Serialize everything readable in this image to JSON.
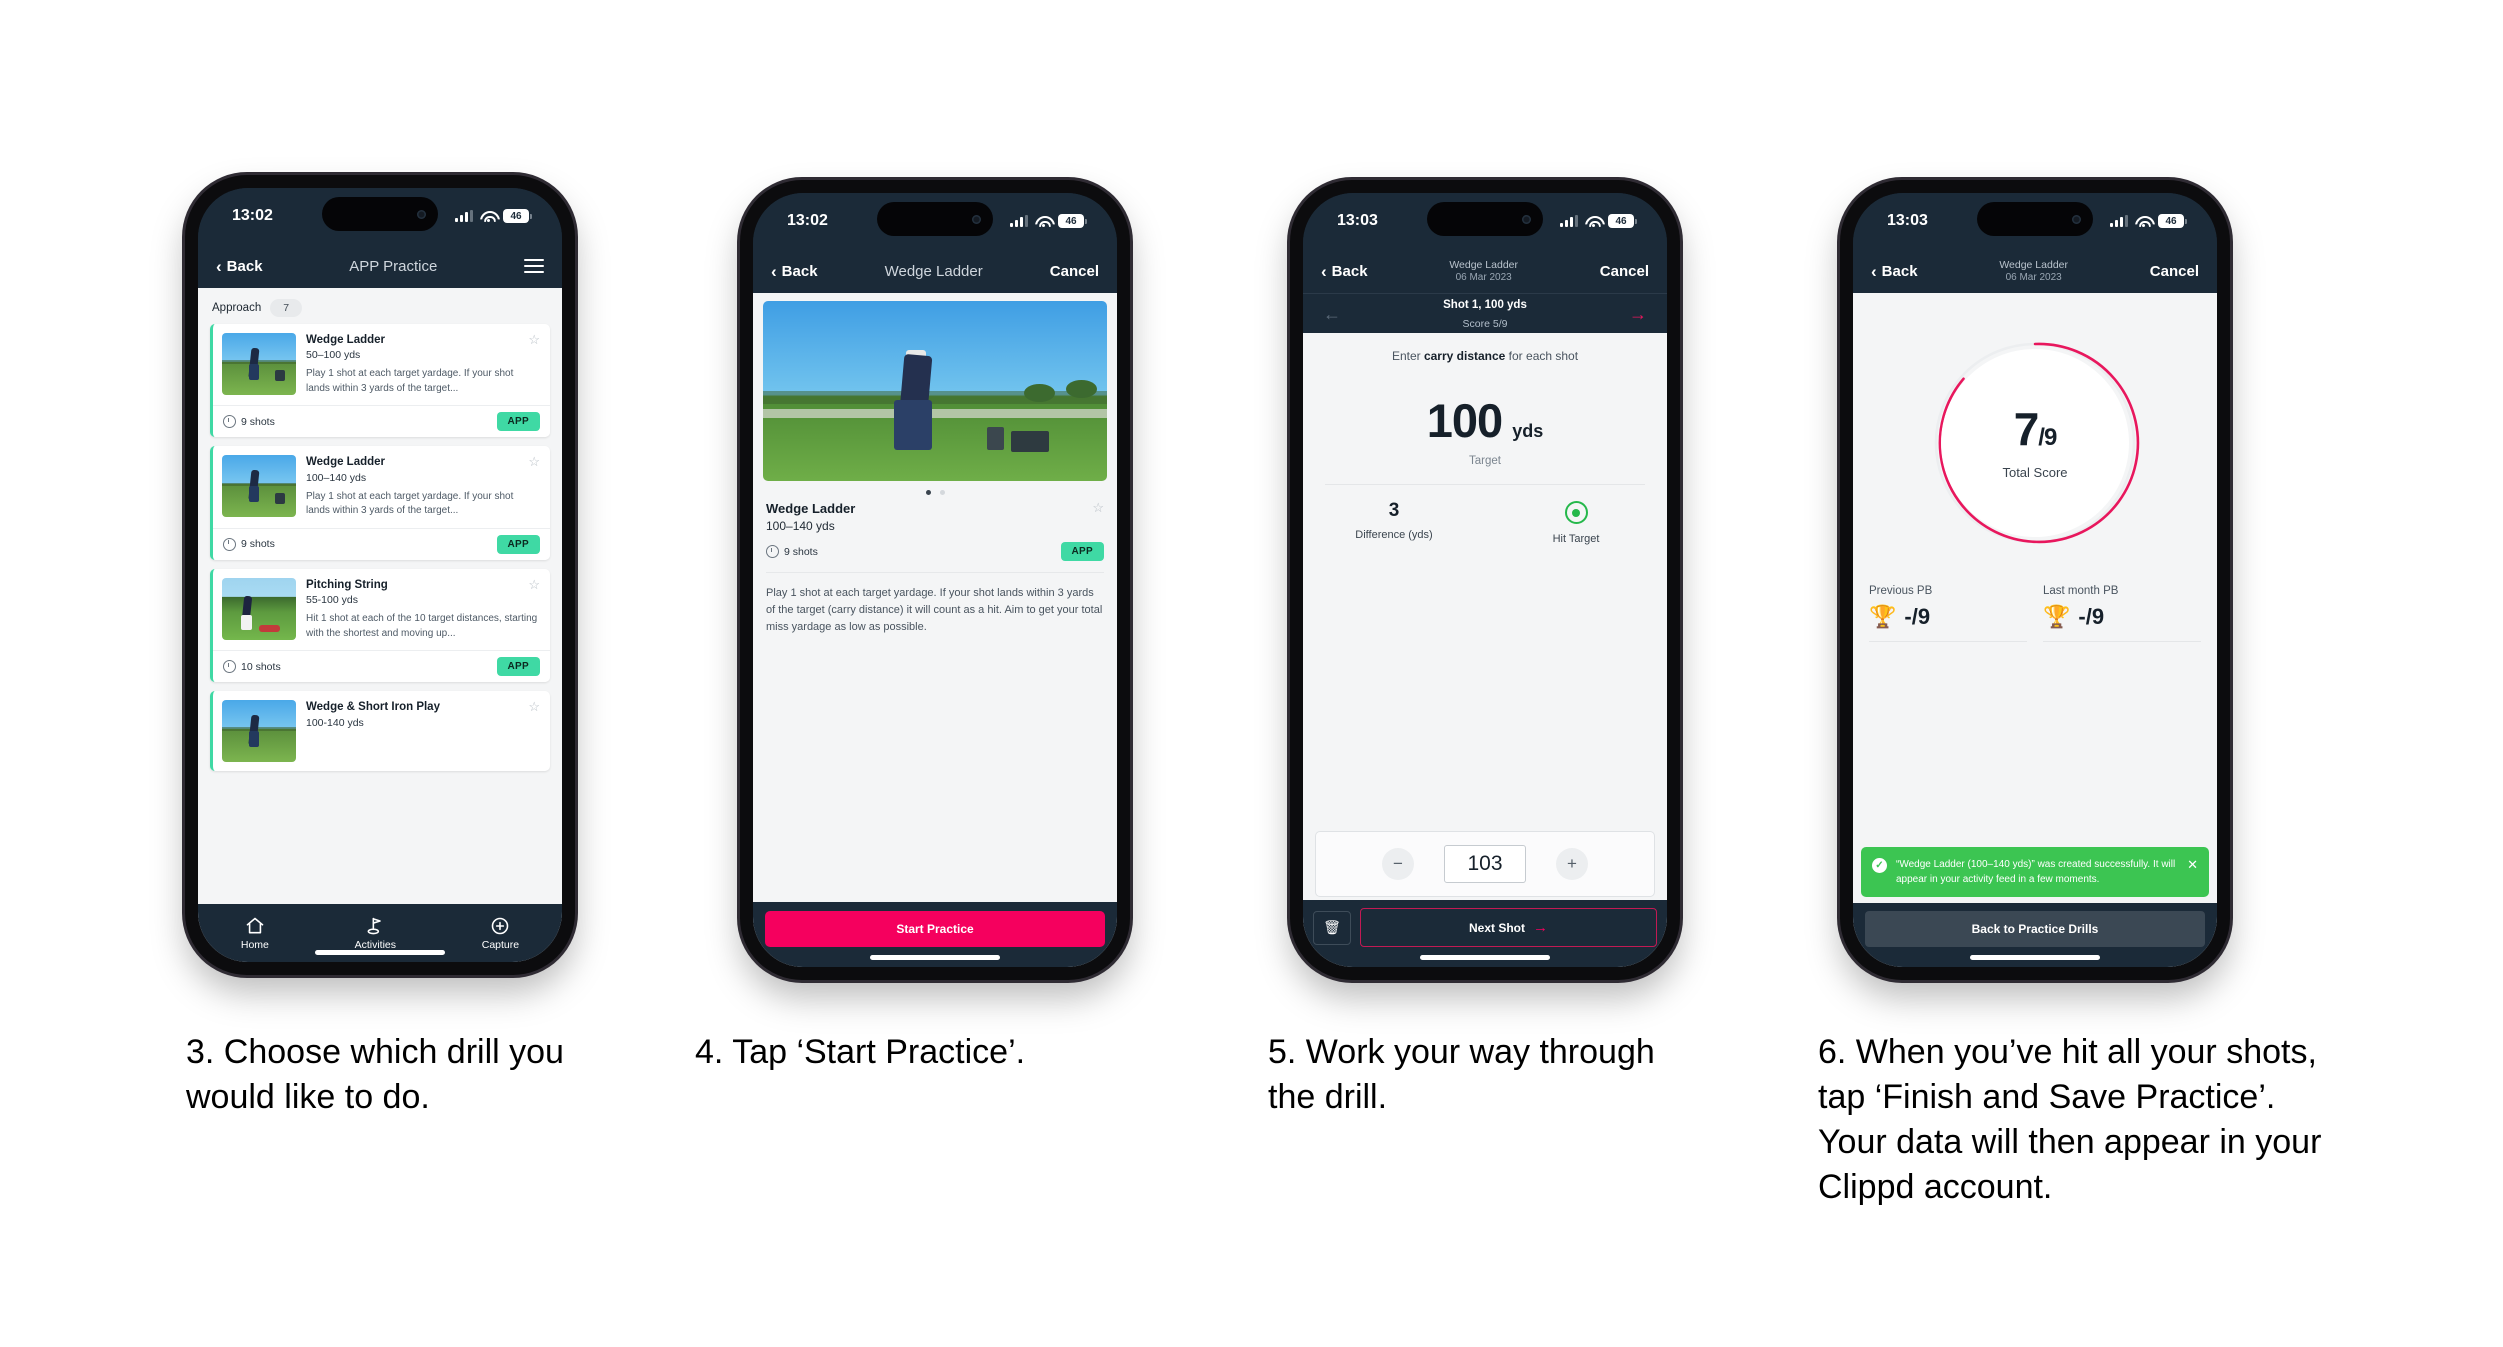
{
  "colors": {
    "dark_navy": "#1b2a38",
    "accent_pink": "#f5005e",
    "mint": "#3fd9a4",
    "toast_green": "#3cc552",
    "hit_green": "#25b84b",
    "page_bg": "#ffffff"
  },
  "phones": [
    {
      "status": {
        "time": "13:02",
        "battery": "46"
      },
      "nav": {
        "back": "Back",
        "title": "APP Practice",
        "menu_icon": "hamburger-icon"
      },
      "filter": {
        "label": "Approach",
        "count": "7"
      },
      "cards": [
        {
          "title": "Wedge Ladder",
          "yardage": "50–100 yds",
          "description": "Play 1 shot at each target yardage. If your shot lands within 3 yards of the target...",
          "shots": "9 shots",
          "badge": "APP"
        },
        {
          "title": "Wedge Ladder",
          "yardage": "100–140 yds",
          "description": "Play 1 shot at each target yardage. If your shot lands within 3 yards of the target...",
          "shots": "9 shots",
          "badge": "APP"
        },
        {
          "title": "Pitching String",
          "yardage": "55-100 yds",
          "description": "Hit 1 shot at each of the 10 target distances, starting with the shortest and moving up...",
          "shots": "10 shots",
          "badge": "APP"
        },
        {
          "title": "Wedge & Short Iron Play",
          "yardage": "100-140 yds",
          "description": "",
          "shots": "",
          "badge": ""
        }
      ],
      "tabs": [
        {
          "label": "Home",
          "icon": "home-icon"
        },
        {
          "label": "Activities",
          "icon": "golf-flag-icon"
        },
        {
          "label": "Capture",
          "icon": "plus-circle-icon"
        }
      ]
    },
    {
      "status": {
        "time": "13:02",
        "battery": "46"
      },
      "nav": {
        "back": "Back",
        "title": "Wedge Ladder",
        "cancel": "Cancel"
      },
      "detail": {
        "title": "Wedge Ladder",
        "yardage": "100–140 yds",
        "shots": "9 shots",
        "badge": "APP",
        "description": "Play 1 shot at each target yardage. If your shot lands within 3 yards of the target (carry distance) it will count as a hit. Aim to get your total miss yardage as low as possible."
      },
      "cta": "Start Practice"
    },
    {
      "status": {
        "time": "13:03",
        "battery": "46"
      },
      "nav": {
        "back": "Back",
        "title": "Wedge Ladder",
        "subtitle": "06 Mar 2023",
        "cancel": "Cancel"
      },
      "subnav": {
        "shot": "Shot 1, 100 yds",
        "score": "Score 5/9"
      },
      "entry": {
        "prompt_pre": "Enter ",
        "prompt_bold": "carry distance",
        "prompt_post": " for each shot",
        "target_value": "100",
        "target_unit": "yds",
        "target_label": "Target",
        "difference_value": "3",
        "difference_label": "Difference (yds)",
        "hit_label": "Hit Target",
        "stepper_value": "103",
        "minus": "−",
        "plus": "+"
      },
      "footer": {
        "delete_icon": "trash-icon",
        "next": "Next Shot"
      }
    },
    {
      "status": {
        "time": "13:03",
        "battery": "46"
      },
      "nav": {
        "back": "Back",
        "title": "Wedge Ladder",
        "subtitle": "06 Mar 2023",
        "cancel": "Cancel"
      },
      "summary": {
        "score_num": "7",
        "score_den": "/9",
        "score_label": "Total Score",
        "pbs": [
          {
            "label": "Previous PB",
            "value": "-/9",
            "icon": "trophy-icon"
          },
          {
            "label": "Last month PB",
            "value": "-/9",
            "icon": "trophy-icon"
          }
        ],
        "toast": "“Wedge Ladder (100–140 yds)” was created successfully. It will appear in your activity feed in a few moments.",
        "toast_close": "✕",
        "cta": "Back to Practice Drills"
      }
    }
  ],
  "captions": [
    "3. Choose which drill you would like to do.",
    "4. Tap ‘Start Practice’.",
    "5. Work your way through the drill.",
    "6. When you’ve hit all your shots, tap ‘Finish and Save Practice’. Your data will then appear in your Clippd account."
  ]
}
